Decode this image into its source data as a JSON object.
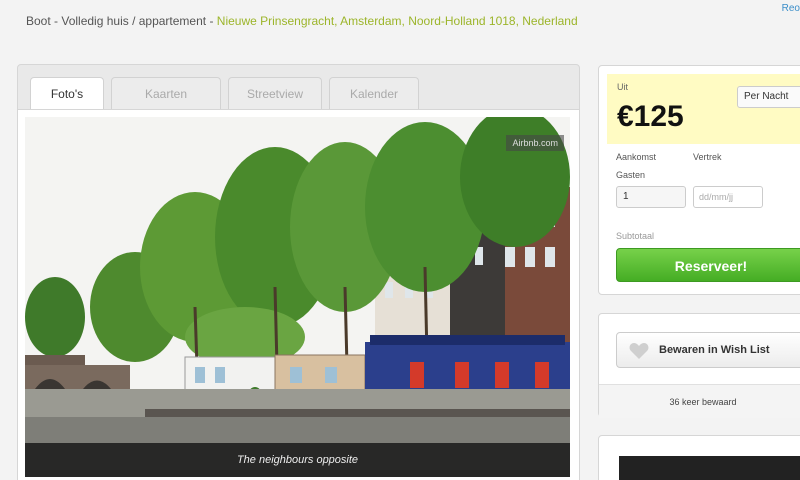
{
  "header": {
    "type_text": "Boot - Volledig huis / appartement - ",
    "location_text": "Nieuwe Prinsengracht, Amsterdam, Noord-Holland 1018, Nederland",
    "top_right_link": "Reo"
  },
  "tabs": [
    {
      "label": "Foto's",
      "active": true
    },
    {
      "label": "Kaarten",
      "active": false
    },
    {
      "label": "Streetview",
      "active": false
    },
    {
      "label": "Kalender",
      "active": false
    }
  ],
  "photo": {
    "watermark": "Airbnb.com",
    "caption": "The neighbours opposite"
  },
  "booking": {
    "from_label": "Uit",
    "price": "€125",
    "period_select": "Per Nacht",
    "checkin_label": "Aankomst",
    "checkout_label": "Vertrek",
    "guests_label": "Gasten",
    "guests_value": "1",
    "date_placeholder": "dd/mm/jj",
    "subtotal_label": "Subtotaal",
    "reserve_label": "Reserveer!"
  },
  "wishlist": {
    "button_label": "Bewaren in Wish List",
    "count_text": "36 keer bewaard"
  },
  "colors": {
    "location_link": "#9cb52a",
    "reserve_green": "#4db32a",
    "price_band": "#fffbc3"
  }
}
